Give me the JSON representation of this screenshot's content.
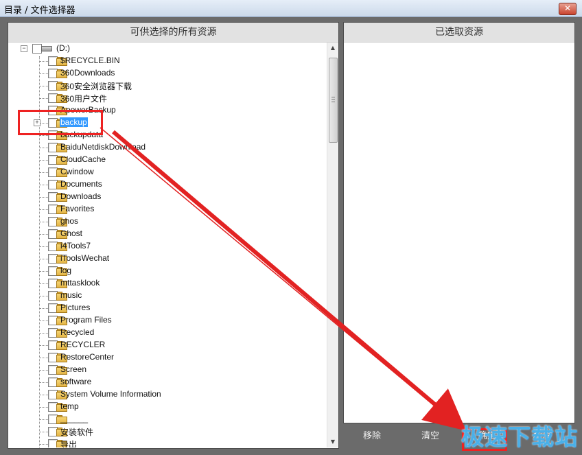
{
  "window": {
    "title": "目录 / 文件选择器",
    "close_glyph": "✕"
  },
  "left_panel": {
    "header": "可供选择的所有资源"
  },
  "right_panel": {
    "header": "已选取资源"
  },
  "tree": {
    "root": {
      "label": "(D:)",
      "expander": "−"
    },
    "items": [
      {
        "label": "$RECYCLE.BIN"
      },
      {
        "label": "360Downloads"
      },
      {
        "label": "360安全浏览器下载"
      },
      {
        "label": "360用户文件"
      },
      {
        "label": "ApowerBackup"
      },
      {
        "label": "backup",
        "selected": true,
        "expander": "+"
      },
      {
        "label": "backupdata"
      },
      {
        "label": "BaiduNetdiskDownload"
      },
      {
        "label": "CloudCache"
      },
      {
        "label": "Cwindow"
      },
      {
        "label": "Documents"
      },
      {
        "label": "Downloads"
      },
      {
        "label": "Favorites"
      },
      {
        "label": "ghos"
      },
      {
        "label": "Ghost"
      },
      {
        "label": "i4Tools7"
      },
      {
        "label": "iToolsWechat"
      },
      {
        "label": "log"
      },
      {
        "label": "mttasklook"
      },
      {
        "label": "music"
      },
      {
        "label": "Pictures"
      },
      {
        "label": "Program Files"
      },
      {
        "label": "Recycled"
      },
      {
        "label": "RECYCLER"
      },
      {
        "label": "RestoreCenter"
      },
      {
        "label": "Screen"
      },
      {
        "label": "software"
      },
      {
        "label": "System Volume Information"
      },
      {
        "label": "temp"
      },
      {
        "label": "______"
      },
      {
        "label": "安装软件"
      },
      {
        "label": "导出"
      }
    ]
  },
  "buttons": {
    "remove": "移除",
    "clear": "清空",
    "confirm": "确定",
    "cancel": "取消"
  },
  "watermark": "极速下载站",
  "colors": {
    "annotation": "#e22222",
    "selection": "#3399ff",
    "watermark": "#4ab0e8"
  }
}
